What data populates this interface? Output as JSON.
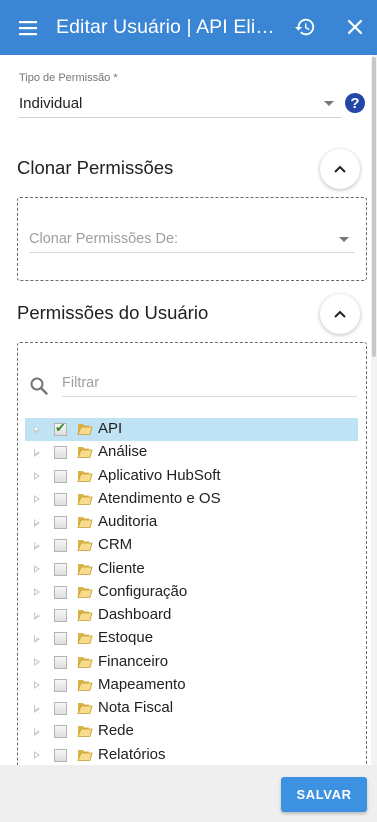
{
  "toolbar": {
    "title": "Editar Usuário | API Elisângela",
    "icons": {
      "menu": "menu-icon",
      "history": "history-icon",
      "close": "close-icon"
    }
  },
  "permission_type": {
    "label": "Tipo de Permissão *",
    "value": "Individual",
    "help": "?"
  },
  "clone_section": {
    "title": "Clonar Permissões",
    "field_placeholder": "Clonar Permissões De:"
  },
  "user_permissions": {
    "title": "Permissões do Usuário",
    "filter_placeholder": "Filtrar",
    "tree": [
      {
        "label": "API",
        "checked": true,
        "selected": true
      },
      {
        "label": "Análise",
        "checked": false,
        "selected": false
      },
      {
        "label": "Aplicativo HubSoft",
        "checked": false,
        "selected": false
      },
      {
        "label": "Atendimento e OS",
        "checked": false,
        "selected": false
      },
      {
        "label": "Auditoria",
        "checked": false,
        "selected": false
      },
      {
        "label": "CRM",
        "checked": false,
        "selected": false
      },
      {
        "label": "Cliente",
        "checked": false,
        "selected": false
      },
      {
        "label": "Configuração",
        "checked": false,
        "selected": false
      },
      {
        "label": "Dashboard",
        "checked": false,
        "selected": false
      },
      {
        "label": "Estoque",
        "checked": false,
        "selected": false
      },
      {
        "label": "Financeiro",
        "checked": false,
        "selected": false
      },
      {
        "label": "Mapeamento",
        "checked": false,
        "selected": false
      },
      {
        "label": "Nota Fiscal",
        "checked": false,
        "selected": false
      },
      {
        "label": "Rede",
        "checked": false,
        "selected": false
      },
      {
        "label": "Relatórios",
        "checked": false,
        "selected": false
      }
    ]
  },
  "footer": {
    "save_label": "SALVAR"
  },
  "colors": {
    "primary": "#3a86d4",
    "selected_row": "#bfe3f5",
    "help": "#2446a8"
  }
}
